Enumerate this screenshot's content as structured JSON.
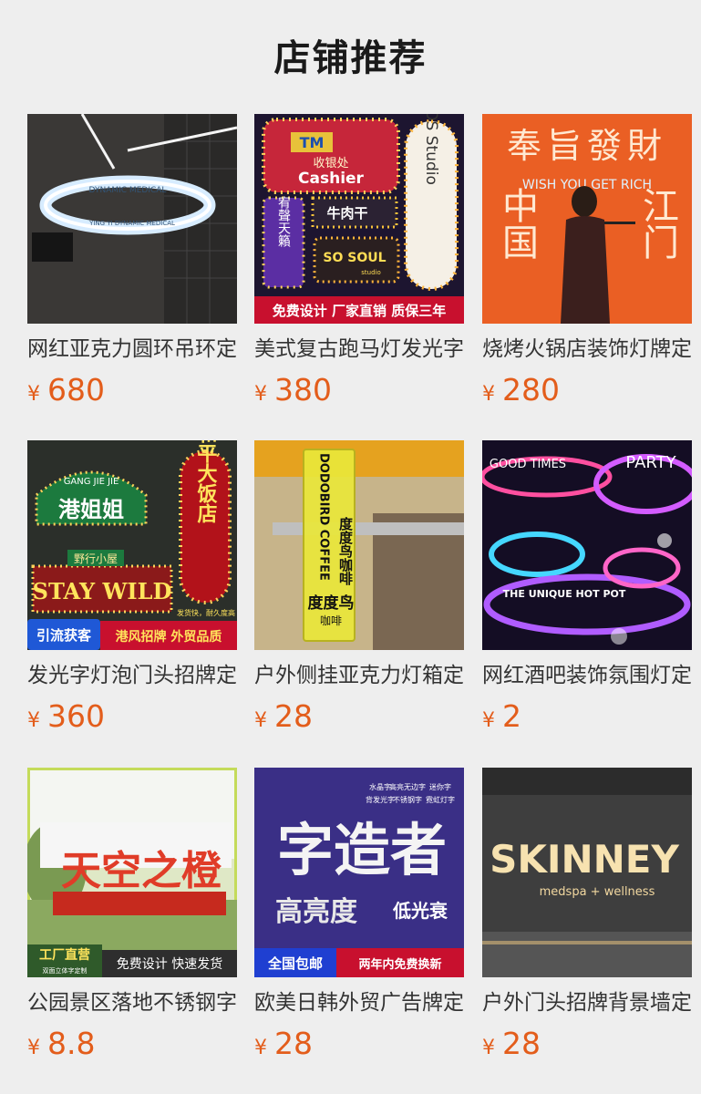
{
  "section": {
    "title": "店铺推荐"
  },
  "currency": "¥",
  "products": [
    {
      "name": "网红亚克力圆环吊环定制",
      "price": "680",
      "image_text": [
        "DYNAMIC MEDICAL",
        "YING YI DYNAMIC MEDICAL"
      ]
    },
    {
      "name": "美式复古跑马灯发光字",
      "price": "380",
      "image_text": [
        "TM",
        "收银处",
        "Cashier",
        "宥聲天籟",
        "牛肉干",
        "SO SOUL",
        "studio",
        "OS Studio",
        "免费设计 厂家直销 质保三年"
      ]
    },
    {
      "name": "烧烤火锅店装饰灯牌定制",
      "price": "280",
      "image_text": [
        "奉旨發財",
        "WISH YOU GET RICH",
        "中国",
        "江门"
      ]
    },
    {
      "name": "发光字灯泡门头招牌定制",
      "price": "360",
      "image_text": [
        "GANG JIE JIE",
        "港姐姐",
        "野行小屋",
        "STAY WILD",
        "和平大饭店",
        "发货快，耐久度高",
        "引流获客",
        "港风招牌 外贸品质"
      ]
    },
    {
      "name": "户外侧挂亚克力灯箱定制",
      "price": "28",
      "image_text": [
        "DODOBIRD COFFEE",
        "度度鸟咖啡",
        "度度鸟",
        "咖啡"
      ]
    },
    {
      "name": "网红酒吧装饰氛围灯定制",
      "price": "2",
      "image_text": [
        "GOOD TIMES",
        "PARTY",
        "THE UNIQUE HOT POT"
      ]
    },
    {
      "name": "公园景区落地不锈钢字定制",
      "price": "8.8",
      "image_text": [
        "天空之橙",
        "工厂直营",
        "双面立体字定制",
        "免费设计 快速发货"
      ]
    },
    {
      "name": "欧美日韩外贸广告牌定制",
      "price": "28",
      "image_text": [
        "水晶字",
        "高亮无边字",
        "迷你字",
        "背发光字",
        "不锈钢字",
        "霓虹灯字",
        "字造者",
        "高亮度",
        "低光衰",
        "全国包邮",
        "两年内免费换新"
      ]
    },
    {
      "name": "户外门头招牌背景墙定制",
      "price": "28",
      "image_text": [
        "SKINNEY",
        "medspa + wellness"
      ]
    }
  ],
  "colors": {
    "price": "#e35d1b",
    "background": "#eeeeee",
    "title": "#1a1a1a"
  }
}
